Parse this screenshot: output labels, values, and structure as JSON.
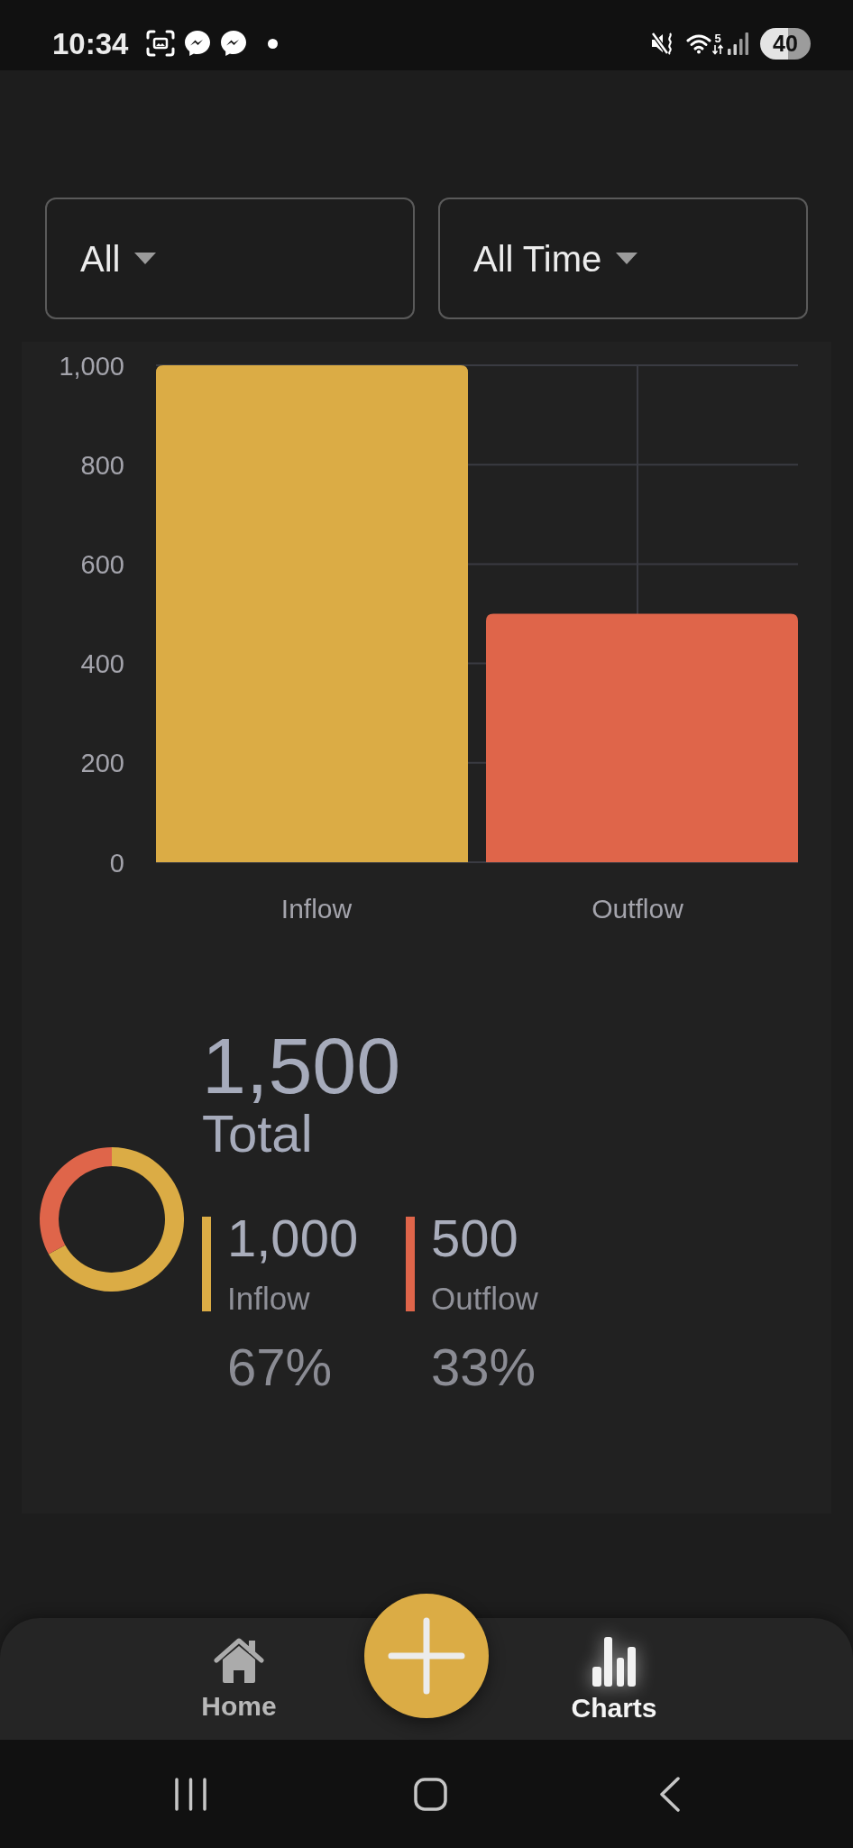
{
  "status_bar": {
    "time": "10:34",
    "wifi_band": "5",
    "battery": "40"
  },
  "filters": [
    {
      "value": "All"
    },
    {
      "value": "All Time"
    }
  ],
  "bar_chart": {
    "chart_data": {
      "type": "bar",
      "categories": [
        "Inflow",
        "Outflow"
      ],
      "series": [
        {
          "color": "#dbac45",
          "values": [
            1000,
            null
          ]
        },
        {
          "color": "#df654a",
          "values": [
            null,
            500
          ]
        }
      ],
      "stacked": true,
      "grid": true,
      "ylim": [
        0,
        1000
      ],
      "yticks": [
        0,
        200,
        400,
        600,
        800,
        {
          "value": 1000,
          "label": "1,000"
        }
      ]
    }
  },
  "summary": {
    "total": {
      "value": "1,500",
      "label": "Total"
    },
    "chart_data": {
      "type": "donut",
      "values": [
        67,
        33
      ]
    },
    "legend": [
      {
        "value": "1,000",
        "label": "Inflow",
        "percent": "67%",
        "color": "#dbac45"
      },
      {
        "value": "500",
        "label": "Outflow",
        "percent": "33%",
        "color": "#df654a"
      }
    ]
  },
  "bottom_nav": {
    "items": [
      {
        "label": "Home",
        "selected": false
      },
      {
        "label": "Charts",
        "selected": true
      }
    ]
  }
}
